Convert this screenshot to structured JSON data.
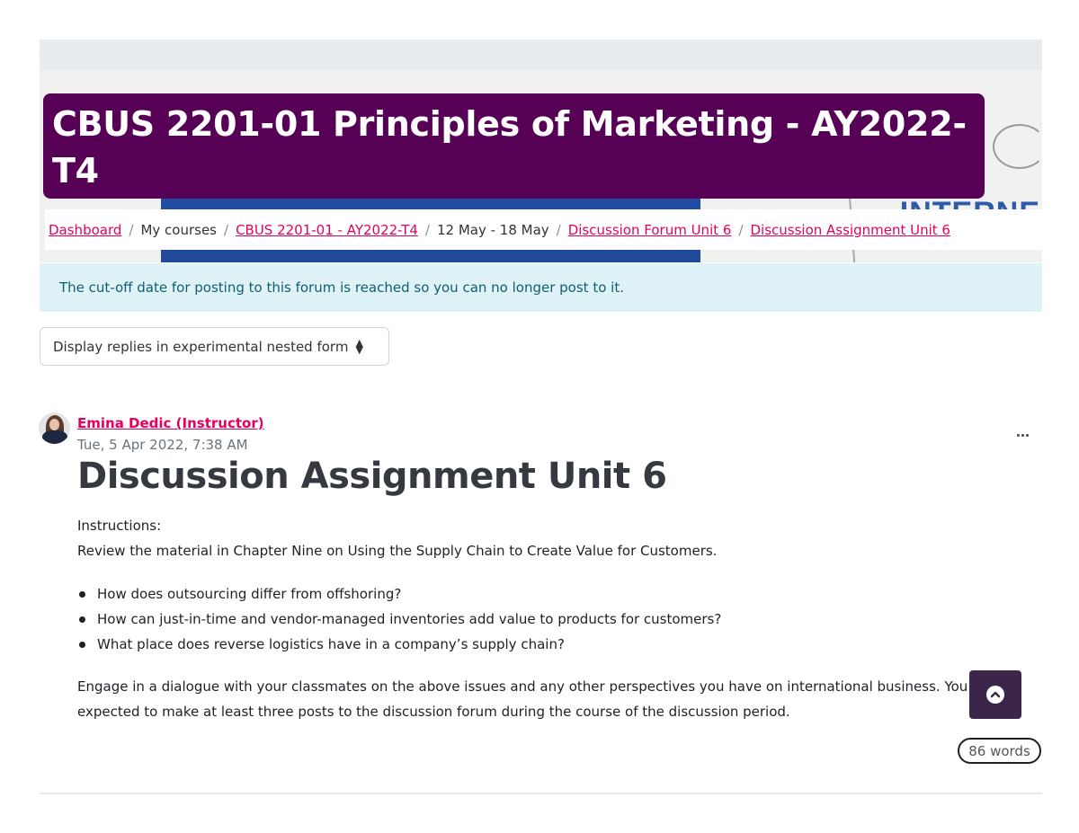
{
  "header": {
    "course_title": "CBUS 2201-01 Principles of Marketing - AY2022-T4",
    "banner_words": [
      "INTERNE"
    ]
  },
  "breadcrumb": [
    {
      "label": "Dashboard",
      "link": true
    },
    {
      "label": "My courses",
      "link": false
    },
    {
      "label": "CBUS 2201-01 - AY2022-T4",
      "link": true
    },
    {
      "label": "12 May - 18 May",
      "link": false
    },
    {
      "label": "Discussion Forum Unit 6",
      "link": true
    },
    {
      "label": "Discussion Assignment Unit 6",
      "link": true
    }
  ],
  "alert": {
    "message": "The cut-off date for posting to this forum is reached so you can no longer post to it."
  },
  "display_select": {
    "selected": "Display replies in experimental nested form"
  },
  "post": {
    "author": "Emina Dedic (Instructor)",
    "date": "Tue, 5 Apr 2022, 7:38 AM",
    "title": "Discussion Assignment Unit 6",
    "instructions_label": "Instructions:",
    "intro": "Review the material in Chapter Nine on Using the Supply Chain to Create Value for Customers.",
    "questions": [
      "How does outsourcing differ from offshoring?",
      "How can just-in-time and vendor-managed inventories add value to products for customers?",
      "What place does reverse logistics have in a company’s supply chain?"
    ],
    "engage_text": "Engage in a dialogue with your classmates on the above issues and any other perspectives you have on international business. You are expected to make at least three posts to the discussion forum during the course of the discussion period.",
    "word_count": "86 words"
  },
  "colors": {
    "title_bg": "#560056",
    "link": "#e6005c",
    "alert_bg": "#def2f8",
    "alert_text": "#0f5f6e",
    "back_to_top_bg": "#3b2548"
  }
}
